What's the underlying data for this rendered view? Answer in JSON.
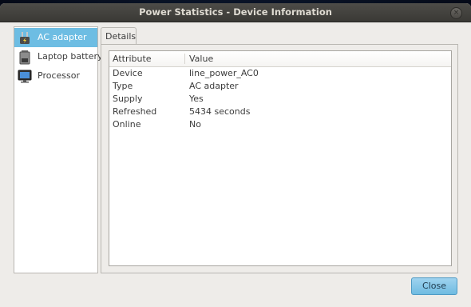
{
  "window": {
    "title": "Power Statistics - Device Information",
    "close_glyph": "×"
  },
  "sidebar": {
    "items": [
      {
        "label": "AC adapter",
        "icon": "ac-adapter-icon",
        "selected": true
      },
      {
        "label": "Laptop battery",
        "icon": "laptop-battery-icon",
        "selected": false
      },
      {
        "label": "Processor",
        "icon": "processor-icon",
        "selected": false
      }
    ]
  },
  "tabs": [
    {
      "label": "Details"
    }
  ],
  "table": {
    "headers": [
      "Attribute",
      "Value"
    ],
    "rows": [
      {
        "attribute": "Device",
        "value": "line_power_AC0"
      },
      {
        "attribute": "Type",
        "value": "AC adapter"
      },
      {
        "attribute": "Supply",
        "value": "Yes"
      },
      {
        "attribute": "Refreshed",
        "value": "5434 seconds"
      },
      {
        "attribute": "Online",
        "value": "No"
      }
    ]
  },
  "buttons": {
    "close_label": "Close"
  },
  "colors": {
    "selection": "#6dbde3",
    "titlebar": "#3c3b37",
    "accent_button": "#8ccae9"
  }
}
